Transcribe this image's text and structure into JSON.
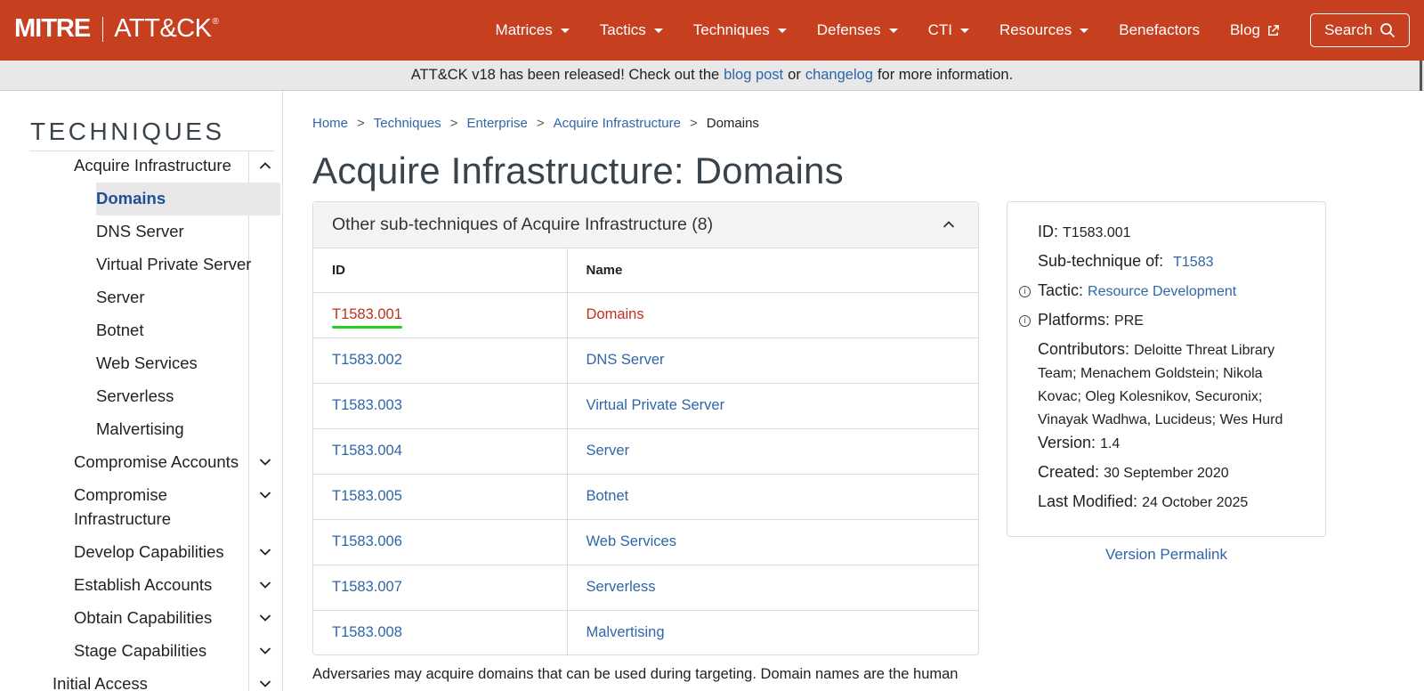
{
  "brand": {
    "mitre": "MITRE",
    "attck": "ATT&CK",
    "reg": "®"
  },
  "nav": {
    "items": [
      "Matrices",
      "Tactics",
      "Techniques",
      "Defenses",
      "CTI",
      "Resources"
    ],
    "benefactors": "Benefactors",
    "blog": "Blog",
    "search": "Search"
  },
  "banner": {
    "prefix": "ATT&CK v18 has been released! Check out the",
    "link1": "blog post",
    "middle": "or",
    "link2": "changelog",
    "suffix": "for more information."
  },
  "sidebar": {
    "title": "TECHNIQUES",
    "parent": "Acquire Infrastructure",
    "subitems": [
      "Domains",
      "DNS Server",
      "Virtual Private Server",
      "Server",
      "Botnet",
      "Web Services",
      "Serverless",
      "Malvertising"
    ],
    "items": [
      "Compromise Accounts",
      "Compromise",
      "Infrastructure",
      "Develop Capabilities",
      "Establish Accounts",
      "Obtain Capabilities",
      "Stage Capabilities",
      "Initial Access"
    ]
  },
  "breadcrumb": [
    "Home",
    "Techniques",
    "Enterprise",
    "Acquire Infrastructure",
    "Domains"
  ],
  "breadcrumb_sep": ">",
  "title": "Acquire Infrastructure: Domains",
  "subtech": {
    "header": "Other sub-techniques of Acquire Infrastructure (8)",
    "col_id": "ID",
    "col_name": "Name",
    "rows": [
      {
        "id": "T1583.001",
        "name": "Domains"
      },
      {
        "id": "T1583.002",
        "name": "DNS Server"
      },
      {
        "id": "T1583.003",
        "name": "Virtual Private Server"
      },
      {
        "id": "T1583.004",
        "name": "Server"
      },
      {
        "id": "T1583.005",
        "name": "Botnet"
      },
      {
        "id": "T1583.006",
        "name": "Web Services"
      },
      {
        "id": "T1583.007",
        "name": "Serverless"
      },
      {
        "id": "T1583.008",
        "name": "Malvertising"
      }
    ]
  },
  "info": {
    "id_label": "ID:",
    "id_value": "T1583.001",
    "sub_label": "Sub-technique of:",
    "sub_value": "T1583",
    "tactic_label": "Tactic:",
    "tactic_value": "Resource Development",
    "platforms_label": "Platforms:",
    "platforms_value": "PRE",
    "contributors_label": "Contributors:",
    "contributors_value": "Deloitte Threat Library Team; Menachem Goldstein; Nikola Kovac; Oleg Kolesnikov, Securonix; Vinayak Wadhwa, Lucideus; Wes Hurd",
    "version_label": "Version:",
    "version_value": "1.4",
    "created_label": "Created:",
    "created_value": "30 September 2020",
    "modified_label": "Last Modified:",
    "modified_value": "24 October 2025",
    "info_glyph": "i"
  },
  "permalink": "Version Permalink",
  "description": "Adversaries may acquire domains that can be used during targeting. Domain names are the human"
}
